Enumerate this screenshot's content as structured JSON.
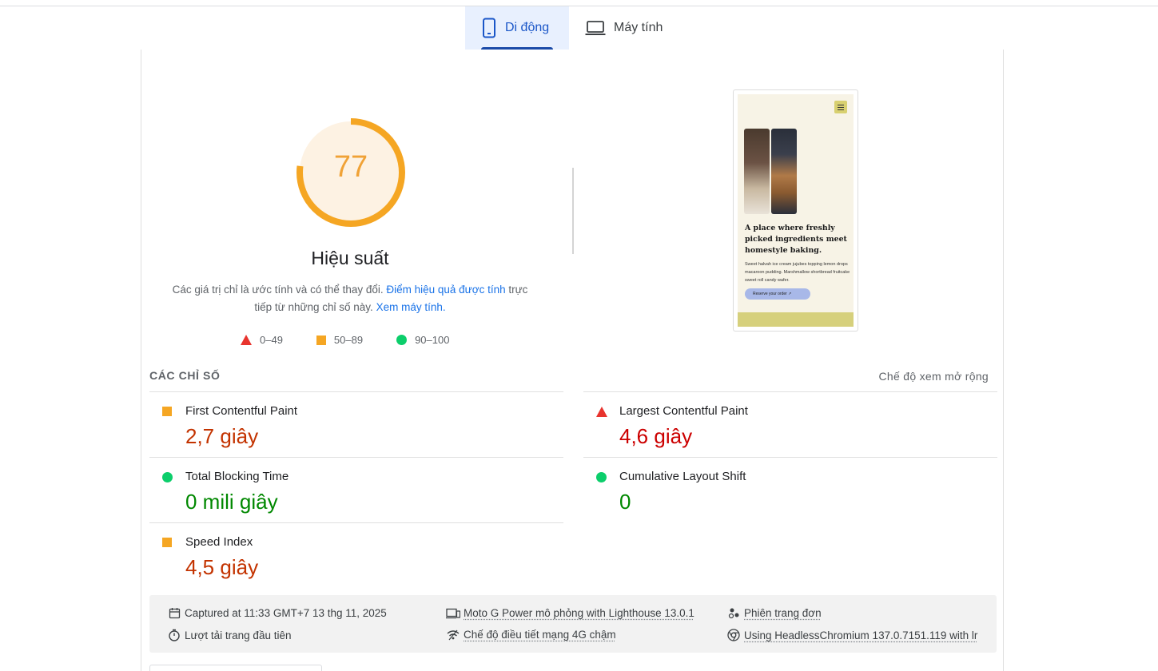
{
  "tabs": [
    {
      "label": "Di động",
      "icon": "smartphone-icon",
      "active": true
    },
    {
      "label": "Máy tính",
      "icon": "laptop-icon",
      "active": false
    }
  ],
  "performance": {
    "score": "77",
    "score_value": 77,
    "title": "Hiệu suất",
    "desc_prefix": "Các giá trị chỉ là ước tính và có thể thay đổi. ",
    "desc_link1": "Điểm hiệu quả được tính",
    "desc_mid": " trực tiếp từ những chỉ số này. ",
    "desc_link2": "Xem máy tính."
  },
  "legend": {
    "fail": "0–49",
    "average": "50–89",
    "pass": "90–100"
  },
  "screenshot": {
    "heading": "A place where freshly picked ingredients meet homestyle baking.",
    "body": "Sweet halvah ice cream jujubes topping lemon drops macaroon pudding. Marshmallow shortbread fruitcake sweet roll candy wafer.",
    "button": "Reserve your order ↗"
  },
  "metrics": {
    "section_title": "CÁC CHỈ SỐ",
    "expand_label": "Chế độ xem mở rộng",
    "items": [
      {
        "name": "First Contentful Paint",
        "value": "2,7 giây",
        "status": "average"
      },
      {
        "name": "Largest Contentful Paint",
        "value": "4,6 giây",
        "status": "fail"
      },
      {
        "name": "Total Blocking Time",
        "value": "0 mili giây",
        "status": "pass"
      },
      {
        "name": "Cumulative Layout Shift",
        "value": "0",
        "status": "pass"
      },
      {
        "name": "Speed Index",
        "value": "4,5 giây",
        "status": "average"
      }
    ]
  },
  "footer": {
    "captured": "Captured at 11:33 GMT+7 13 thg 11, 2025",
    "first_load": "Lượt tải trang đầu tiên",
    "device": "Moto G Power mô phỏng with Lighthouse 13.0.1",
    "network": "Chế độ điều tiết mạng 4G chậm",
    "session": "Phiên trang đơn",
    "browser": "Using HeadlessChromium 137.0.7151.119 with lr"
  },
  "colors": {
    "accent": "#1a56c8",
    "score_orange": "#f0a236",
    "fail_red": "#e8342e",
    "average_orange": "#f5a623",
    "pass_green": "#0cce6b"
  }
}
